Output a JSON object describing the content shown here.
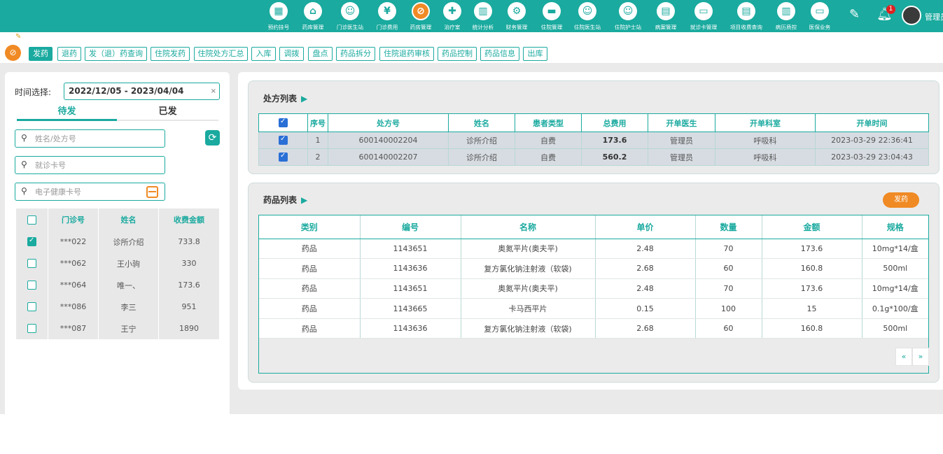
{
  "header": {
    "nav": [
      {
        "label": "预约挂号",
        "icon": "calendar-icon",
        "glyph": "▦"
      },
      {
        "label": "药库管理",
        "icon": "warehouse-icon",
        "glyph": "⌂"
      },
      {
        "label": "门诊医生站",
        "icon": "doctor-icon",
        "glyph": "☺"
      },
      {
        "label": "门诊费用",
        "icon": "yen-icon",
        "glyph": "¥"
      },
      {
        "label": "药房管理",
        "icon": "pill-icon",
        "glyph": "⊘"
      },
      {
        "label": "治疗室",
        "icon": "syringe-icon",
        "glyph": "✚"
      },
      {
        "label": "统计分析",
        "icon": "chart-icon",
        "glyph": "▥"
      },
      {
        "label": "财务管理",
        "icon": "finance-icon",
        "glyph": "⚙"
      },
      {
        "label": "住院管理",
        "icon": "bed-icon",
        "glyph": "▬"
      },
      {
        "label": "住院医生站",
        "icon": "inpatient-doctor-icon",
        "glyph": "☺"
      },
      {
        "label": "住院护士站",
        "icon": "nurse-icon",
        "glyph": "☺"
      },
      {
        "label": "病案管理",
        "icon": "record-icon",
        "glyph": "▤"
      },
      {
        "label": "就诊卡管理",
        "icon": "card-icon",
        "glyph": "▭"
      },
      {
        "label": "项目收费查询",
        "icon": "invoice-icon",
        "glyph": "▤"
      },
      {
        "label": "病历质控",
        "icon": "quality-icon",
        "glyph": "▥"
      },
      {
        "label": "医保业务",
        "icon": "insurance-icon",
        "glyph": "▭"
      }
    ],
    "active_index": 4,
    "notification_count": "1",
    "user_name": "管理员"
  },
  "tabs": [
    "发药",
    "退药",
    "发（退）药查询",
    "住院发药",
    "住院处方汇总",
    "入库",
    "调拨",
    "盘点",
    "药品拆分",
    "住院退药审核",
    "药品控制",
    "药品信息",
    "出库"
  ],
  "left": {
    "time_label": "时间选择:",
    "date_range": "2022/12/05 - 2023/04/04",
    "clear_icon": "×",
    "tab_pending": "待发",
    "tab_done": "已发",
    "search_name_placeholder": "姓名/处方号",
    "search_card_placeholder": "就诊卡号",
    "search_health_placeholder": "电子健康卡号",
    "columns": [
      "门诊号",
      "姓名",
      "收费金额"
    ],
    "patients": [
      {
        "no": "***022",
        "name": "诊所介绍",
        "amount": "733.8",
        "checked": true
      },
      {
        "no": "***062",
        "name": "王小驹",
        "amount": "330",
        "checked": false
      },
      {
        "no": "***064",
        "name": "唯一、",
        "amount": "173.6",
        "checked": false
      },
      {
        "no": "***086",
        "name": "李三",
        "amount": "951",
        "checked": false
      },
      {
        "no": "***087",
        "name": "王宁",
        "amount": "1890",
        "checked": false
      }
    ]
  },
  "prescriptions": {
    "title": "处方列表",
    "columns": [
      "序号",
      "处方号",
      "姓名",
      "患者类型",
      "总费用",
      "开单医生",
      "开单科室",
      "开单时间"
    ],
    "rows": [
      {
        "seq": "1",
        "rx_no": "600140002204",
        "name": "诊所介绍",
        "type": "自费",
        "total": "173.6",
        "doctor": "管理员",
        "dept": "呼吸科",
        "time": "2023-03-29 22:36:41"
      },
      {
        "seq": "2",
        "rx_no": "600140002207",
        "name": "诊所介绍",
        "type": "自费",
        "total": "560.2",
        "doctor": "管理员",
        "dept": "呼吸科",
        "time": "2023-03-29 23:04:43"
      }
    ]
  },
  "drugs": {
    "title": "药品列表",
    "dispense_label": "发药",
    "columns": [
      "类别",
      "编号",
      "名称",
      "单价",
      "数量",
      "金额",
      "规格"
    ],
    "rows": [
      [
        "药品",
        "1143651",
        "奥氮平片(奥夫平)",
        "2.48",
        "70",
        "173.6",
        "10mg*14/盒"
      ],
      [
        "药品",
        "1143636",
        "复方氯化钠注射液（软袋)",
        "2.68",
        "60",
        "160.8",
        "500ml"
      ],
      [
        "药品",
        "1143651",
        "奥氮平片(奥夫平)",
        "2.48",
        "70",
        "173.6",
        "10mg*14/盒"
      ],
      [
        "药品",
        "1143665",
        "卡马西平片",
        "0.15",
        "100",
        "15",
        "0.1g*100/盒"
      ],
      [
        "药品",
        "1143636",
        "复方氯化钠注射液（软袋)",
        "2.68",
        "60",
        "160.8",
        "500ml"
      ]
    ],
    "pager_prev": "«",
    "pager_next": "»"
  },
  "colors": {
    "primary": "#1aaa9f",
    "accent": "#f08a24",
    "badge": "#e02020"
  }
}
